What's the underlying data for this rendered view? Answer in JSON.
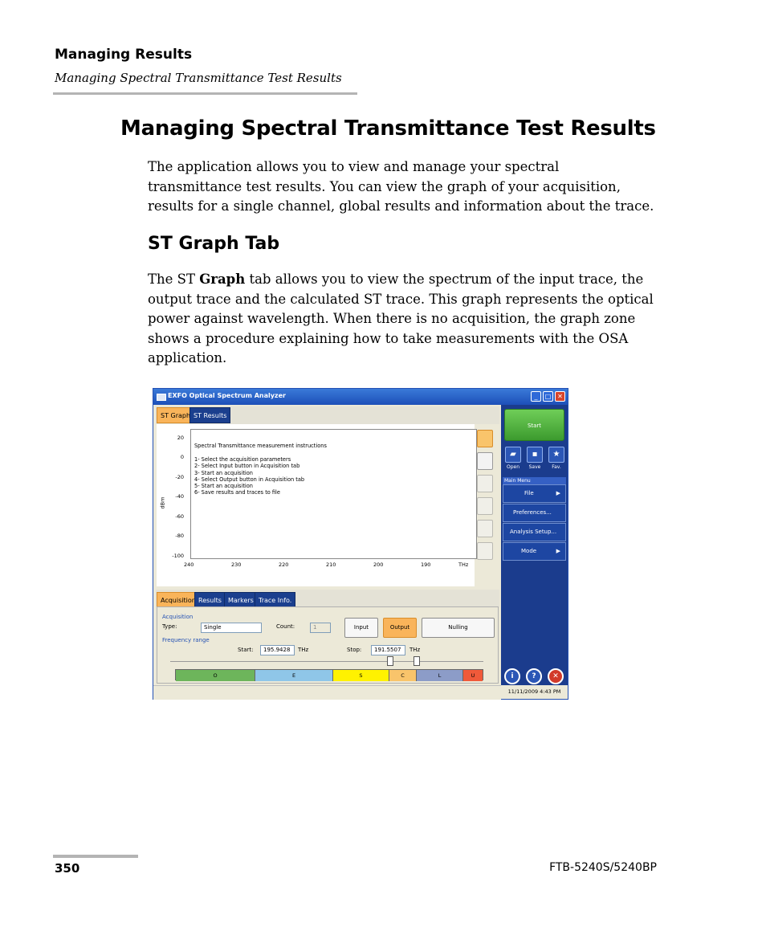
{
  "header": {
    "section": "Managing Results",
    "subsection": "Managing Spectral Transmittance Test Results"
  },
  "title": "Managing Spectral Transmittance Test Results",
  "intro": {
    "lines": [
      "The application allows you to view and manage your spectral",
      "transmittance test results. You can view the graph of your acquisition,",
      "results for a single channel, global results and information about the trace."
    ]
  },
  "section_heading": "ST Graph Tab",
  "body": {
    "line1_pre": "The ST ",
    "line1_bold": "Graph",
    "line1_post": " tab allows you to view the spectrum of the input trace, the",
    "lines": [
      "output trace and the calculated ST trace. This graph represents the optical",
      "power against wavelength. When there is no acquisition, the graph zone",
      "shows a procedure explaining how to take measurements with the OSA",
      "application."
    ]
  },
  "screenshot": {
    "window_title": "EXFO Optical Spectrum Analyzer",
    "tabs": [
      "ST Graph",
      "ST Results"
    ],
    "y_ticks": [
      "20",
      "0",
      "-20",
      "-40",
      "-60",
      "-80",
      "-100"
    ],
    "y_unit": "dBm",
    "x_ticks": [
      "240",
      "230",
      "220",
      "210",
      "200",
      "190"
    ],
    "x_unit": "THz",
    "instructions_title": "Spectral Transmittance measurement instructions",
    "instructions": [
      "1- Select the acquisition parameters",
      "2- Select Input button in Acquisition tab",
      "3- Start an acquisition",
      "4- Select Output button in Acquisition tab",
      "5- Start an acquisition",
      "6- Save results and traces to file"
    ],
    "start_label": "Start",
    "quick_buttons": [
      "Open",
      "Save",
      "Fav."
    ],
    "main_menu_label": "Main Menu",
    "menu_items": [
      "File",
      "Preferences...",
      "Analysis Setup...",
      "Mode"
    ],
    "lower_tabs": [
      "Acquisition",
      "Results",
      "Markers",
      "Trace Info."
    ],
    "acquisition_label": "Acquisition",
    "type_label": "Type:",
    "type_value": "Single",
    "count_label": "Count:",
    "count_value": "1",
    "input_button": "Input",
    "output_button": "Output",
    "nulling_button": "Nulling",
    "frequency_range_label": "Frequency range",
    "start_label_f": "Start:",
    "start_value": "195.9428",
    "stop_label_f": "Stop:",
    "stop_value": "191.5507",
    "unit_thz": "THz",
    "bands": [
      "O",
      "E",
      "S",
      "C",
      "L",
      "U"
    ],
    "band_colors": [
      "#6db55b",
      "#8fc6e8",
      "#fff200",
      "#f9c46b",
      "#8c9cc8",
      "#f05a3a"
    ],
    "status_datetime": "11/11/2009 4:43 PM"
  },
  "footer": {
    "page_number": "350",
    "model": "FTB-5240S/5240BP"
  }
}
